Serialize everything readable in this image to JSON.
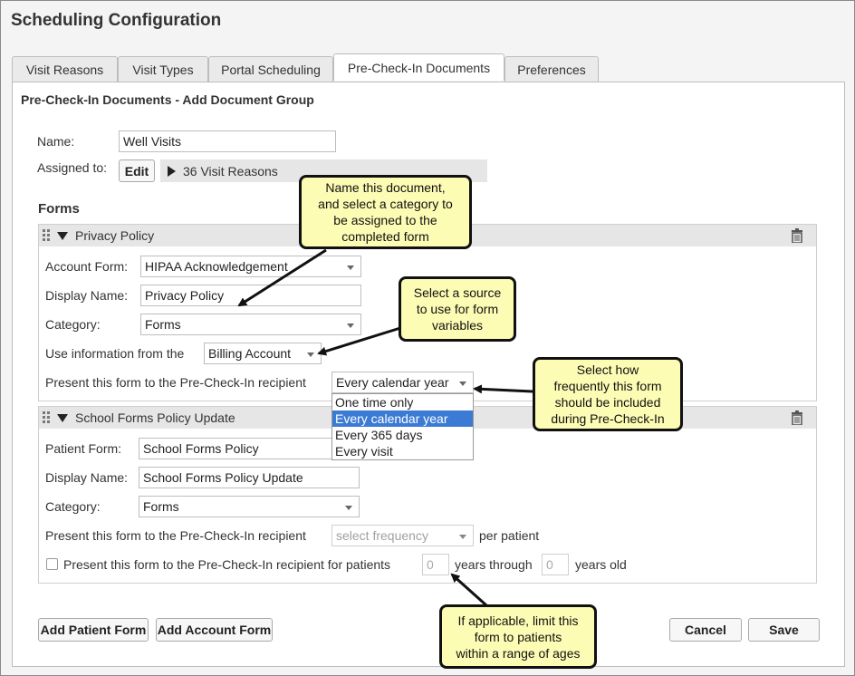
{
  "app": {
    "title": "Scheduling Configuration"
  },
  "tabs": [
    {
      "label": "Visit Reasons"
    },
    {
      "label": "Visit Types"
    },
    {
      "label": "Portal Scheduling"
    },
    {
      "label": "Pre-Check-In Documents",
      "active": true
    },
    {
      "label": "Preferences"
    }
  ],
  "page": {
    "heading": "Pre-Check-In Documents - Add Document Group"
  },
  "group": {
    "name_label": "Name:",
    "name_value": "Well Visits",
    "assigned_label": "Assigned to:",
    "edit_button": "Edit",
    "assigned_summary": "36 Visit Reasons"
  },
  "forms_heading": "Forms",
  "form1": {
    "title": "Privacy Policy",
    "account_form_label": "Account Form:",
    "account_form_value": "HIPAA Acknowledgement",
    "display_name_label": "Display Name:",
    "display_name_value": "Privacy Policy",
    "category_label": "Category:",
    "category_value": "Forms",
    "use_info_label": "Use information from the",
    "use_info_value": "Billing Account",
    "present_label": "Present this form to the Pre-Check-In recipient",
    "frequency_value": "Every calendar year",
    "frequency_options": [
      "One time only",
      "Every calendar year",
      "Every 365 days",
      "Every visit"
    ],
    "frequency_selected_index": 1
  },
  "form2": {
    "title": "School Forms Policy Update",
    "patient_form_label": "Patient Form:",
    "patient_form_value": "School Forms Policy",
    "display_name_label": "Display Name:",
    "display_name_value": "School Forms Policy Update",
    "category_label": "Category:",
    "category_value": "Forms",
    "present_label": "Present this form to the Pre-Check-In recipient",
    "frequency_placeholder": "select frequency",
    "per_patient_label": "per patient",
    "age_checkbox_label": "Present this form to the Pre-Check-In recipient for patients",
    "age_from_value": "0",
    "years_through_label": "years through",
    "age_to_value": "0",
    "years_old_label": "years old",
    "age_checkbox_checked": false
  },
  "footer": {
    "add_patient_form": "Add Patient Form",
    "add_account_form": "Add Account Form",
    "cancel": "Cancel",
    "save": "Save"
  },
  "callouts": {
    "name_doc": [
      "Name this document,",
      "and select a category to",
      "be assigned to the",
      "completed form"
    ],
    "source": [
      "Select a source",
      "to use for form",
      "variables"
    ],
    "frequency": [
      "Select how",
      "frequently this form",
      "should be included",
      "during Pre-Check-In"
    ],
    "ages": [
      "If applicable, limit this",
      "form to patients",
      "within a range of ages"
    ]
  },
  "colors": {
    "callout_fill": "#fdfcb4",
    "selected_option": "#3b7bd4"
  }
}
